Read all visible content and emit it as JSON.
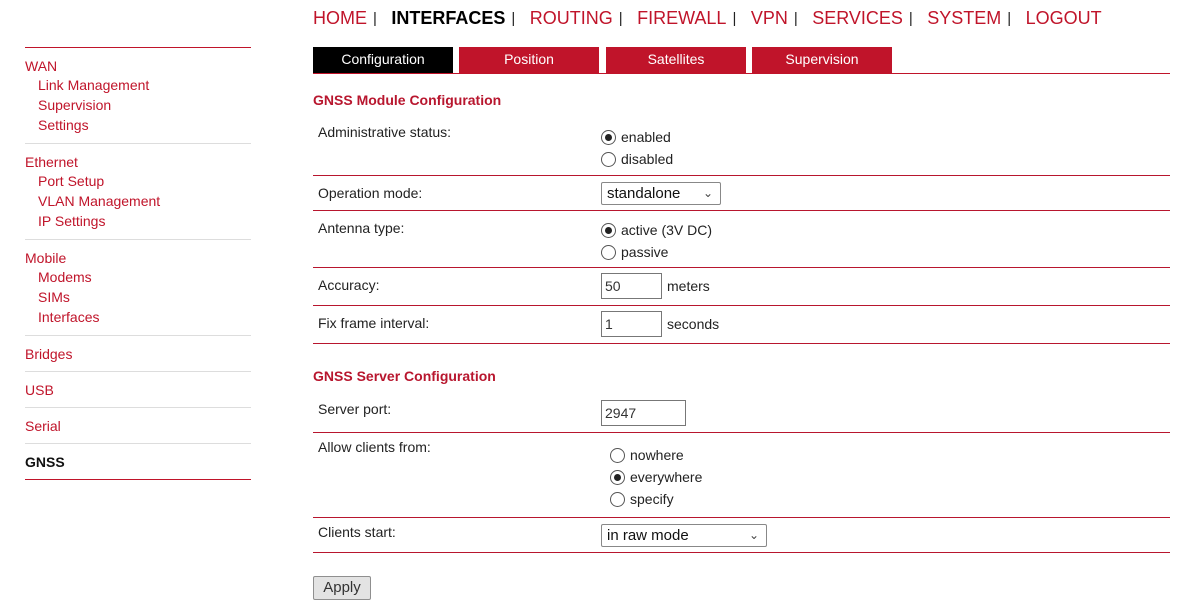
{
  "colors": {
    "accent": "#c0142a",
    "active_tab": "#000000"
  },
  "topnav": {
    "items": [
      "HOME",
      "INTERFACES",
      "ROUTING",
      "FIREWALL",
      "VPN",
      "SERVICES",
      "SYSTEM",
      "LOGOUT"
    ],
    "active": "INTERFACES",
    "separator": "|"
  },
  "sidebar": {
    "groups": [
      {
        "label": "WAN",
        "items": [
          "Link Management",
          "Supervision",
          "Settings"
        ]
      },
      {
        "label": "Ethernet",
        "items": [
          "Port Setup",
          "VLAN Management",
          "IP Settings"
        ]
      },
      {
        "label": "Mobile",
        "items": [
          "Modems",
          "SIMs",
          "Interfaces"
        ]
      },
      {
        "label": "Bridges",
        "items": []
      },
      {
        "label": "USB",
        "items": []
      },
      {
        "label": "Serial",
        "items": []
      },
      {
        "label": "GNSS",
        "items": []
      }
    ],
    "active": "GNSS"
  },
  "tabs": {
    "items": [
      "Configuration",
      "Position",
      "Satellites",
      "Supervision"
    ],
    "active": "Configuration"
  },
  "module_config": {
    "title": "GNSS Module Configuration",
    "admin_status": {
      "label": "Administrative status:",
      "options": [
        "enabled",
        "disabled"
      ],
      "selected": "enabled"
    },
    "operation_mode": {
      "label": "Operation mode:",
      "value": "standalone"
    },
    "antenna_type": {
      "label": "Antenna type:",
      "options": [
        "active (3V DC)",
        "passive"
      ],
      "selected": "active (3V DC)"
    },
    "accuracy": {
      "label": "Accuracy:",
      "value": "50",
      "unit": "meters"
    },
    "fix_interval": {
      "label": "Fix frame interval:",
      "value": "1",
      "unit": "seconds"
    }
  },
  "server_config": {
    "title": "GNSS Server Configuration",
    "server_port": {
      "label": "Server port:",
      "value": "2947"
    },
    "allow_clients": {
      "label": "Allow clients from:",
      "options": [
        "nowhere",
        "everywhere",
        "specify"
      ],
      "selected": "everywhere"
    },
    "clients_start": {
      "label": "Clients start:",
      "value": "in raw mode"
    }
  },
  "apply_label": "Apply"
}
